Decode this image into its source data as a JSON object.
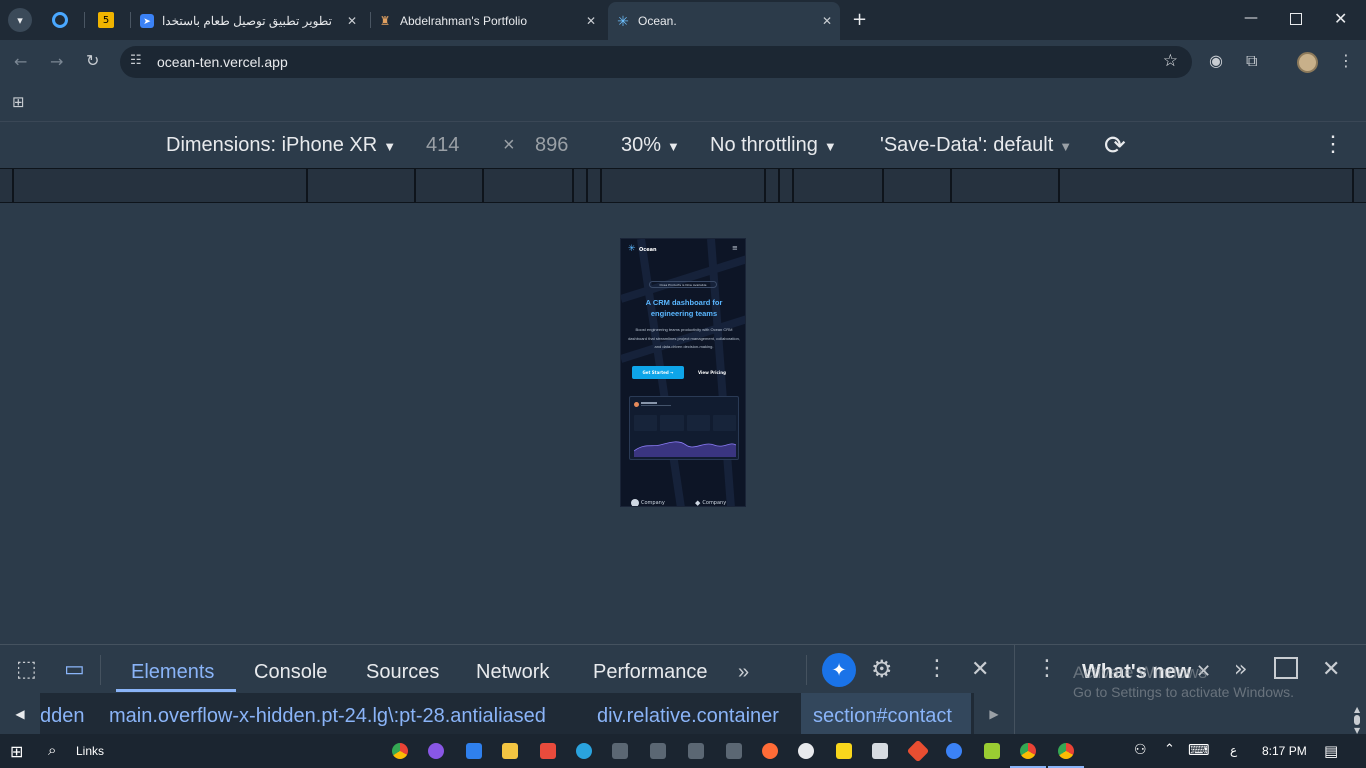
{
  "tabs": [
    {
      "title": "تطوير تطبيق توصيل طعام باستخدام",
      "icon": "wing-icon"
    },
    {
      "title": "Abdelrahman's Portfolio",
      "icon": "portfolio-icon"
    },
    {
      "title": "Ocean.",
      "icon": "snowflake-icon"
    }
  ],
  "pinned_tabs": [
    {
      "icon": "circle-icon"
    },
    {
      "label": "5"
    }
  ],
  "address": {
    "url": "ocean-ten.vercel.app"
  },
  "device_toolbar": {
    "dimensions_label": "Dimensions: iPhone XR",
    "width": "414",
    "times": "×",
    "height": "896",
    "zoom": "30%",
    "throttling": "No throttling",
    "save_data": "'Save-Data': default"
  },
  "phone": {
    "brand": "Ocean",
    "pill": "Ocea Products is Now Available",
    "headline": "A CRM dashboard for engineering teams",
    "body": "Boost engineering teams productivity with Ocean CRM dashboard that streamlines project management, collaboration, and data-driven decision-making.",
    "cta_primary": "Get Started →",
    "cta_secondary": "View Pricing",
    "logos": [
      "Company",
      "Company"
    ]
  },
  "devtools": {
    "tabs": [
      "Elements",
      "Console",
      "Sources",
      "Network",
      "Performance"
    ],
    "active_tab": "Elements",
    "whats_new": "What's new",
    "breadcrumbs": [
      "dden",
      "main.overflow-x-hidden.pt-24.lg\\:pt-28.antialiased",
      "div.relative.container",
      "section#contact"
    ],
    "watermark_line1": "Activate Windows",
    "watermark_line2": "Go to Settings to activate Windows."
  },
  "taskbar": {
    "search_label": "Links",
    "lang": "ع",
    "time": "8:17 PM"
  },
  "colors": {
    "accent": "#8ab4f8",
    "phone_cta": "#0ea5e9",
    "headline": "#5ab7ff"
  }
}
